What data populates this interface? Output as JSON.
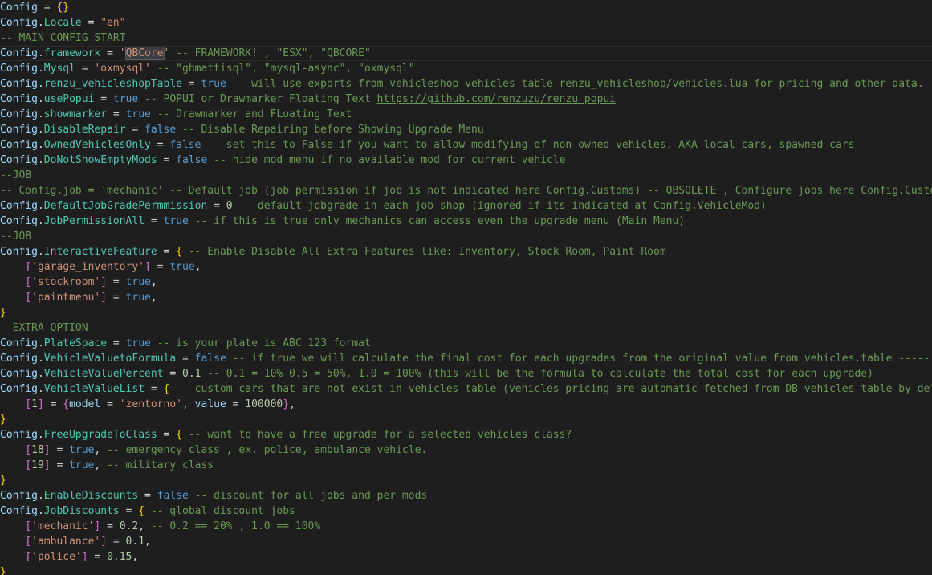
{
  "editor": {
    "lines": [
      [
        {
          "t": "Config",
          "c": "var"
        },
        {
          "t": " = ",
          "c": "op"
        },
        {
          "t": "{}",
          "c": "brace1"
        }
      ],
      [
        {
          "t": "Config",
          "c": "var"
        },
        {
          "t": ".",
          "c": "op"
        },
        {
          "t": "Locale",
          "c": "prop"
        },
        {
          "t": " = ",
          "c": "op"
        },
        {
          "t": "\"en\"",
          "c": "str"
        }
      ],
      [
        {
          "t": "-- MAIN CONFIG START",
          "c": "comment"
        }
      ],
      [
        {
          "t": "Config",
          "c": "var"
        },
        {
          "t": ".",
          "c": "op"
        },
        {
          "t": "framework",
          "c": "prop"
        },
        {
          "t": " = ",
          "c": "op"
        },
        {
          "t": "'",
          "c": "str"
        },
        {
          "t": "QBCore",
          "c": "str sel"
        },
        {
          "t": "'",
          "c": "str"
        },
        {
          "t": " -- FRAMEWORK! , \"ESX\", \"QBCORE\"",
          "c": "comment"
        }
      ],
      [
        {
          "t": "Config",
          "c": "var"
        },
        {
          "t": ".",
          "c": "op"
        },
        {
          "t": "Mysql",
          "c": "prop"
        },
        {
          "t": " = ",
          "c": "op"
        },
        {
          "t": "'oxmysql'",
          "c": "str"
        },
        {
          "t": " -- \"ghmattisql\", \"mysql-async\", \"oxmysql\"",
          "c": "comment"
        }
      ],
      [
        {
          "t": "Config",
          "c": "var"
        },
        {
          "t": ".",
          "c": "op"
        },
        {
          "t": "renzu_vehicleshopTable",
          "c": "prop"
        },
        {
          "t": " = ",
          "c": "op"
        },
        {
          "t": "true",
          "c": "kw"
        },
        {
          "t": " -- will use exports from vehicleshop vehicles table renzu_vehicleshop/vehicles.lua for pricing and other data.",
          "c": "comment"
        }
      ],
      [
        {
          "t": "Config",
          "c": "var"
        },
        {
          "t": ".",
          "c": "op"
        },
        {
          "t": "usePopui",
          "c": "prop"
        },
        {
          "t": " = ",
          "c": "op"
        },
        {
          "t": "true",
          "c": "kw"
        },
        {
          "t": " -- POPUI or Drawmarker Floating Text ",
          "c": "comment"
        },
        {
          "t": "https://github.com/renzuzu/renzu_popui",
          "c": "link"
        }
      ],
      [
        {
          "t": "Config",
          "c": "var"
        },
        {
          "t": ".",
          "c": "op"
        },
        {
          "t": "showmarker",
          "c": "prop"
        },
        {
          "t": " = ",
          "c": "op"
        },
        {
          "t": "true",
          "c": "kw"
        },
        {
          "t": " -- Drawmarker and FLoating Text",
          "c": "comment"
        }
      ],
      [
        {
          "t": "Config",
          "c": "var"
        },
        {
          "t": ".",
          "c": "op"
        },
        {
          "t": "DisableRepair",
          "c": "prop"
        },
        {
          "t": " = ",
          "c": "op"
        },
        {
          "t": "false",
          "c": "kw"
        },
        {
          "t": " -- Disable Repairing before Showing Upgrade Menu",
          "c": "comment"
        }
      ],
      [
        {
          "t": "Config",
          "c": "var"
        },
        {
          "t": ".",
          "c": "op"
        },
        {
          "t": "OwnedVehiclesOnly",
          "c": "prop"
        },
        {
          "t": " = ",
          "c": "op"
        },
        {
          "t": "false",
          "c": "kw"
        },
        {
          "t": " -- set this to False if you want to allow modifying of non owned vehicles, AKA local cars, spawned cars",
          "c": "comment"
        }
      ],
      [
        {
          "t": "Config",
          "c": "var"
        },
        {
          "t": ".",
          "c": "op"
        },
        {
          "t": "DoNotShowEmptyMods",
          "c": "prop"
        },
        {
          "t": " = ",
          "c": "op"
        },
        {
          "t": "false",
          "c": "kw"
        },
        {
          "t": " -- hide mod menu if no available mod for current vehicle",
          "c": "comment"
        }
      ],
      [
        {
          "t": "--JOB",
          "c": "comment"
        }
      ],
      [
        {
          "t": "-- Config.job = 'mechanic' -- Default job (job permission if job is not indicated here Config.Customs) -- OBSOLETE , Configure jobs here Config.Customs",
          "c": "comment"
        }
      ],
      [
        {
          "t": "Config",
          "c": "var"
        },
        {
          "t": ".",
          "c": "op"
        },
        {
          "t": "DefaultJobGradePermmission",
          "c": "prop"
        },
        {
          "t": " = ",
          "c": "op"
        },
        {
          "t": "0",
          "c": "num"
        },
        {
          "t": " -- default jobgrade in each job shop (ignored if its indicated at Config.VehicleMod)",
          "c": "comment"
        }
      ],
      [
        {
          "t": "Config",
          "c": "var"
        },
        {
          "t": ".",
          "c": "op"
        },
        {
          "t": "JobPermissionAll",
          "c": "prop"
        },
        {
          "t": " = ",
          "c": "op"
        },
        {
          "t": "true",
          "c": "kw"
        },
        {
          "t": " -- if this is true only mechanics can access even the upgrade menu (Main Menu)",
          "c": "comment"
        }
      ],
      [
        {
          "t": "--JOB",
          "c": "comment"
        }
      ],
      [
        {
          "t": "Config",
          "c": "var"
        },
        {
          "t": ".",
          "c": "op"
        },
        {
          "t": "InteractiveFeature",
          "c": "prop"
        },
        {
          "t": " = ",
          "c": "op"
        },
        {
          "t": "{",
          "c": "brace1"
        },
        {
          "t": " -- Enable Disable All Extra Features like: Inventory, Stock Room, Paint Room",
          "c": "comment"
        }
      ],
      [
        {
          "t": "    ",
          "c": "plain"
        },
        {
          "t": "[",
          "c": "brace2"
        },
        {
          "t": "'garage_inventory'",
          "c": "str"
        },
        {
          "t": "]",
          "c": "brace2"
        },
        {
          "t": " = ",
          "c": "op"
        },
        {
          "t": "true",
          "c": "kw"
        },
        {
          "t": ",",
          "c": "op"
        }
      ],
      [
        {
          "t": "    ",
          "c": "plain"
        },
        {
          "t": "[",
          "c": "brace2"
        },
        {
          "t": "'stockroom'",
          "c": "str"
        },
        {
          "t": "]",
          "c": "brace2"
        },
        {
          "t": " = ",
          "c": "op"
        },
        {
          "t": "true",
          "c": "kw"
        },
        {
          "t": ",",
          "c": "op"
        }
      ],
      [
        {
          "t": "    ",
          "c": "plain"
        },
        {
          "t": "[",
          "c": "brace2"
        },
        {
          "t": "'paintmenu'",
          "c": "str"
        },
        {
          "t": "]",
          "c": "brace2"
        },
        {
          "t": " = ",
          "c": "op"
        },
        {
          "t": "true",
          "c": "kw"
        },
        {
          "t": ",",
          "c": "op"
        }
      ],
      [
        {
          "t": "}",
          "c": "brace1"
        }
      ],
      [
        {
          "t": "--EXTRA OPTION",
          "c": "comment"
        }
      ],
      [
        {
          "t": "Config",
          "c": "var"
        },
        {
          "t": ".",
          "c": "op"
        },
        {
          "t": "PlateSpace",
          "c": "prop"
        },
        {
          "t": " = ",
          "c": "op"
        },
        {
          "t": "true",
          "c": "kw"
        },
        {
          "t": " -- is your plate is ABC 123 format",
          "c": "comment"
        }
      ],
      [
        {
          "t": "Config",
          "c": "var"
        },
        {
          "t": ".",
          "c": "op"
        },
        {
          "t": "VehicleValuetoFormula",
          "c": "prop"
        },
        {
          "t": " = ",
          "c": "op"
        },
        {
          "t": "false",
          "c": "kw"
        },
        {
          "t": " -- if true we will calculate the final cost for each upgrades from the original value from vehicles.table ----- (",
          "c": "comment"
        }
      ],
      [
        {
          "t": "Config",
          "c": "var"
        },
        {
          "t": ".",
          "c": "op"
        },
        {
          "t": "VehicleValuePercent",
          "c": "prop"
        },
        {
          "t": " = ",
          "c": "op"
        },
        {
          "t": "0.1",
          "c": "num"
        },
        {
          "t": " -- 0.1 = 10% 0.5 = 50%, 1.0 = 100% (this will be the formula to calculate the total cost for each upgrade)",
          "c": "comment"
        }
      ],
      [
        {
          "t": "Config",
          "c": "var"
        },
        {
          "t": ".",
          "c": "op"
        },
        {
          "t": "VehicleValueList",
          "c": "prop"
        },
        {
          "t": " = ",
          "c": "op"
        },
        {
          "t": "{",
          "c": "brace1"
        },
        {
          "t": " -- custom cars that are not exist in vehicles table (vehicles pricing are automatic fetched from DB vehicles table by defau",
          "c": "comment"
        }
      ],
      [
        {
          "t": "    ",
          "c": "plain"
        },
        {
          "t": "[",
          "c": "brace2"
        },
        {
          "t": "1",
          "c": "num"
        },
        {
          "t": "]",
          "c": "brace2"
        },
        {
          "t": " = ",
          "c": "op"
        },
        {
          "t": "{",
          "c": "brace2"
        },
        {
          "t": "model",
          "c": "var"
        },
        {
          "t": " = ",
          "c": "op"
        },
        {
          "t": "'zentorno'",
          "c": "str"
        },
        {
          "t": ", ",
          "c": "op"
        },
        {
          "t": "value",
          "c": "var"
        },
        {
          "t": " = ",
          "c": "op"
        },
        {
          "t": "100000",
          "c": "num"
        },
        {
          "t": "}",
          "c": "brace2"
        },
        {
          "t": ",",
          "c": "op"
        }
      ],
      [
        {
          "t": "}",
          "c": "brace1"
        }
      ],
      [
        {
          "t": "Config",
          "c": "var"
        },
        {
          "t": ".",
          "c": "op"
        },
        {
          "t": "FreeUpgradeToClass",
          "c": "prop"
        },
        {
          "t": " = ",
          "c": "op"
        },
        {
          "t": "{",
          "c": "brace1"
        },
        {
          "t": " -- want to have a free upgrade for a selected vehicles class?",
          "c": "comment"
        }
      ],
      [
        {
          "t": "    ",
          "c": "plain"
        },
        {
          "t": "[",
          "c": "brace2"
        },
        {
          "t": "18",
          "c": "num"
        },
        {
          "t": "]",
          "c": "brace2"
        },
        {
          "t": " = ",
          "c": "op"
        },
        {
          "t": "true",
          "c": "kw"
        },
        {
          "t": ",",
          "c": "op"
        },
        {
          "t": " -- emergency class , ex. police, ambulance vehicle.",
          "c": "comment"
        }
      ],
      [
        {
          "t": "    ",
          "c": "plain"
        },
        {
          "t": "[",
          "c": "brace2"
        },
        {
          "t": "19",
          "c": "num"
        },
        {
          "t": "]",
          "c": "brace2"
        },
        {
          "t": " = ",
          "c": "op"
        },
        {
          "t": "true",
          "c": "kw"
        },
        {
          "t": ",",
          "c": "op"
        },
        {
          "t": " -- military class",
          "c": "comment"
        }
      ],
      [
        {
          "t": "}",
          "c": "brace1"
        }
      ],
      [
        {
          "t": "Config",
          "c": "var"
        },
        {
          "t": ".",
          "c": "op"
        },
        {
          "t": "EnableDiscounts",
          "c": "prop"
        },
        {
          "t": " = ",
          "c": "op"
        },
        {
          "t": "false",
          "c": "kw"
        },
        {
          "t": " -- discount for all jobs and per mods",
          "c": "comment"
        }
      ],
      [
        {
          "t": "Config",
          "c": "var"
        },
        {
          "t": ".",
          "c": "op"
        },
        {
          "t": "JobDiscounts",
          "c": "prop"
        },
        {
          "t": " = ",
          "c": "op"
        },
        {
          "t": "{",
          "c": "brace1"
        },
        {
          "t": " -- global discount jobs",
          "c": "comment"
        }
      ],
      [
        {
          "t": "    ",
          "c": "plain"
        },
        {
          "t": "[",
          "c": "brace2"
        },
        {
          "t": "'mechanic'",
          "c": "str"
        },
        {
          "t": "]",
          "c": "brace2"
        },
        {
          "t": " = ",
          "c": "op"
        },
        {
          "t": "0.2",
          "c": "num"
        },
        {
          "t": ",",
          "c": "op"
        },
        {
          "t": " -- 0.2 == 20% , 1.0 == 100%",
          "c": "comment"
        }
      ],
      [
        {
          "t": "    ",
          "c": "plain"
        },
        {
          "t": "[",
          "c": "brace2"
        },
        {
          "t": "'ambulance'",
          "c": "str"
        },
        {
          "t": "]",
          "c": "brace2"
        },
        {
          "t": " = ",
          "c": "op"
        },
        {
          "t": "0.1",
          "c": "num"
        },
        {
          "t": ",",
          "c": "op"
        }
      ],
      [
        {
          "t": "    ",
          "c": "plain"
        },
        {
          "t": "[",
          "c": "brace2"
        },
        {
          "t": "'police'",
          "c": "str"
        },
        {
          "t": "]",
          "c": "brace2"
        },
        {
          "t": " = ",
          "c": "op"
        },
        {
          "t": "0.15",
          "c": "num"
        },
        {
          "t": ",",
          "c": "op"
        }
      ],
      [
        {
          "t": "}",
          "c": "brace1"
        }
      ]
    ],
    "current_line": 3,
    "theme": {
      "background": "#1e1e1e",
      "comment": "#6a9955",
      "string": "#ce9178",
      "keyword": "#569cd6",
      "variable": "#9cdcfe",
      "property": "#4ec9b0",
      "number": "#b5cea8",
      "brace_level1": "#ffd700",
      "brace_level2": "#da70d6"
    }
  }
}
